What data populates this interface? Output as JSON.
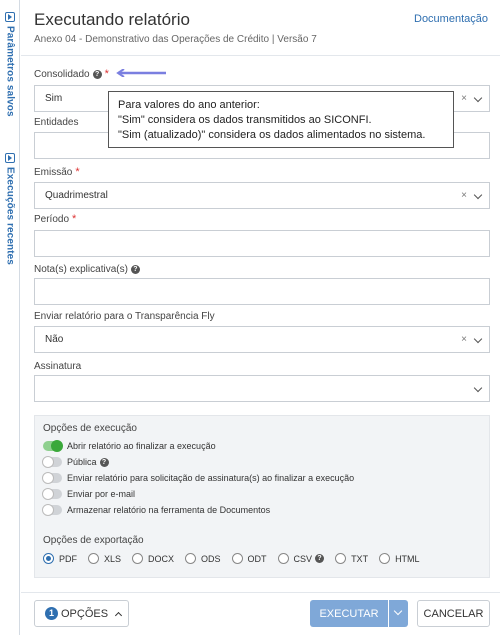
{
  "rail": {
    "saved_params": "Parâmetros salvos",
    "recent_runs": "Execuções recentes"
  },
  "header": {
    "title": "Executando relatório",
    "subtitle": "Anexo 04 - Demonstrativo das Operações de Crédito | Versão 7",
    "doc_link": "Documentação"
  },
  "form": {
    "consolidado": {
      "label": "Consolidado",
      "value": "Sim"
    },
    "entidades": {
      "label": "Entidades",
      "value": ""
    },
    "emissao": {
      "label": "Emissão",
      "value": "Quadrimestral"
    },
    "periodo": {
      "label": "Período",
      "value": ""
    },
    "notas": {
      "label": "Nota(s) explicativa(s)",
      "value": ""
    },
    "transparencia": {
      "label": "Enviar relatório para o Transparência Fly",
      "value": "Não"
    },
    "assinatura": {
      "label": "Assinatura",
      "value": ""
    }
  },
  "tooltip": {
    "line1": "Para valores do ano anterior:",
    "line2": "\"Sim\" considera os dados transmitidos ao SICONFI.",
    "line3": "\"Sim (atualizado)\" considera os dados alimentados no sistema."
  },
  "options": {
    "exec_title": "Opções de execução",
    "toggles": [
      {
        "label": "Abrir relatório ao finalizar a execução",
        "on": true
      },
      {
        "label": "Pública",
        "on": false
      },
      {
        "label": "Enviar relatório para solicitação de assinatura(s) ao finalizar a execução",
        "on": false
      },
      {
        "label": "Enviar por e-mail",
        "on": false
      },
      {
        "label": "Armazenar relatório na ferramenta de Documentos",
        "on": false
      }
    ],
    "export_title": "Opções de exportação",
    "formats": [
      "PDF",
      "XLS",
      "DOCX",
      "ODS",
      "ODT",
      "CSV",
      "TXT",
      "HTML"
    ],
    "selected_format": "PDF"
  },
  "footer": {
    "options_count": "1",
    "options_label": "OPÇÕES",
    "execute_label": "EXECUTAR",
    "cancel_label": "CANCELAR"
  },
  "colors": {
    "accent": "#2f6fb0",
    "execute_bg": "#7fa8d8",
    "toggle_on": "#3aa83a",
    "required": "#dd3333"
  }
}
